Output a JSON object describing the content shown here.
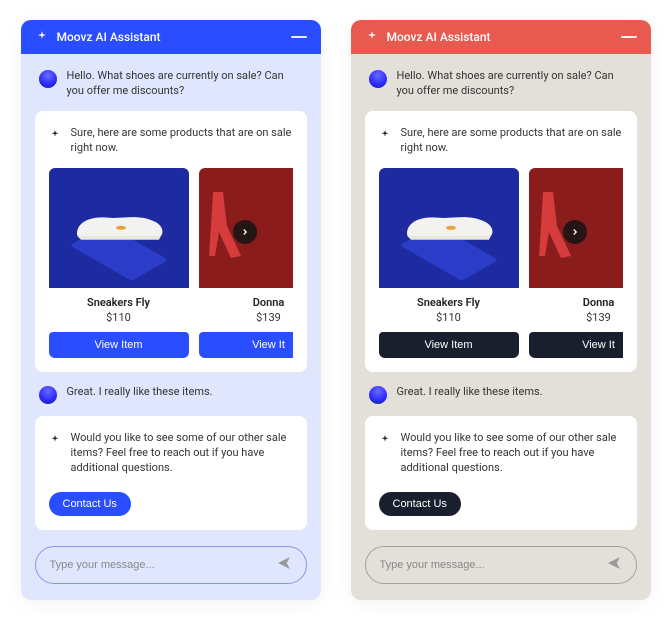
{
  "app_title": "Moovz AI Assistant",
  "user_msg1": "Hello. What shoes are currently on sale? Can you offer me discounts?",
  "ai_msg1": "Sure, here are some products that are on sale right now.",
  "user_msg2": "Great. I really like these items.",
  "ai_msg2": "Would you like to see some of our other sale items? Feel free to reach out if you have additional questions.",
  "contact_label": "Contact Us",
  "view_label": "View Item",
  "view_label_cut": "View It",
  "input_placeholder": "Type your message...",
  "products": [
    {
      "name": "Sneakers Fly",
      "price": "$110"
    },
    {
      "name": "Donna",
      "price_cut": "$139"
    }
  ]
}
